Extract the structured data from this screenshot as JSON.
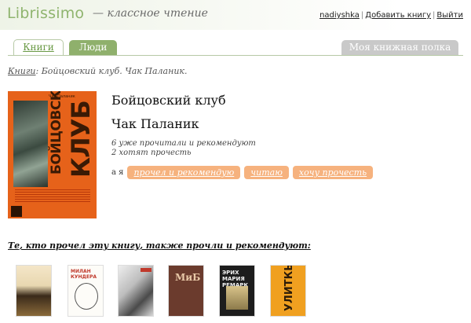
{
  "header": {
    "logo": "Librissimo",
    "tagline_dash": "—",
    "tagline": "классное чтение",
    "links": [
      "nadiyshka",
      "Добавить книгу",
      "Выйти"
    ],
    "separator": "|"
  },
  "tabs": {
    "books": "Книги",
    "people": "Люди",
    "shelf": "Моя книжная полка"
  },
  "breadcrumb": {
    "section": "Книги",
    "rest": ": Бойцовский клуб. Чак Паланик."
  },
  "cover": {
    "author_small": "Чак Паланик",
    "title_line1": "БОЙЦОВСКИЙ",
    "title_line2": "КЛУБ"
  },
  "book": {
    "title": "Бойцовский клуб",
    "author": "Чак Паланик",
    "stat_read": "6 уже прочитали и рекомендуют",
    "stat_want": "2 хотят прочесть",
    "actions_prefix": "а я",
    "actions": [
      "прочел и рекомендую",
      "читаю",
      "хочу прочесть"
    ]
  },
  "recommendations": {
    "heading": "Те, кто прочел эту книгу, также прочли и рекомендуют:",
    "thumb2_title": "МИЛАН КУНДЕРА",
    "thumb4_mark": "МиБ",
    "thumb5_title": "ЭРИХ МАРИЯ РЕМАРК",
    "thumb6_title": "УЛИТКЫ"
  },
  "colors": {
    "brand_green": "#8fb46e",
    "tab_green": "#8fb06c",
    "pill_orange": "#f6b27e",
    "cover_orange": "#e6621a"
  }
}
